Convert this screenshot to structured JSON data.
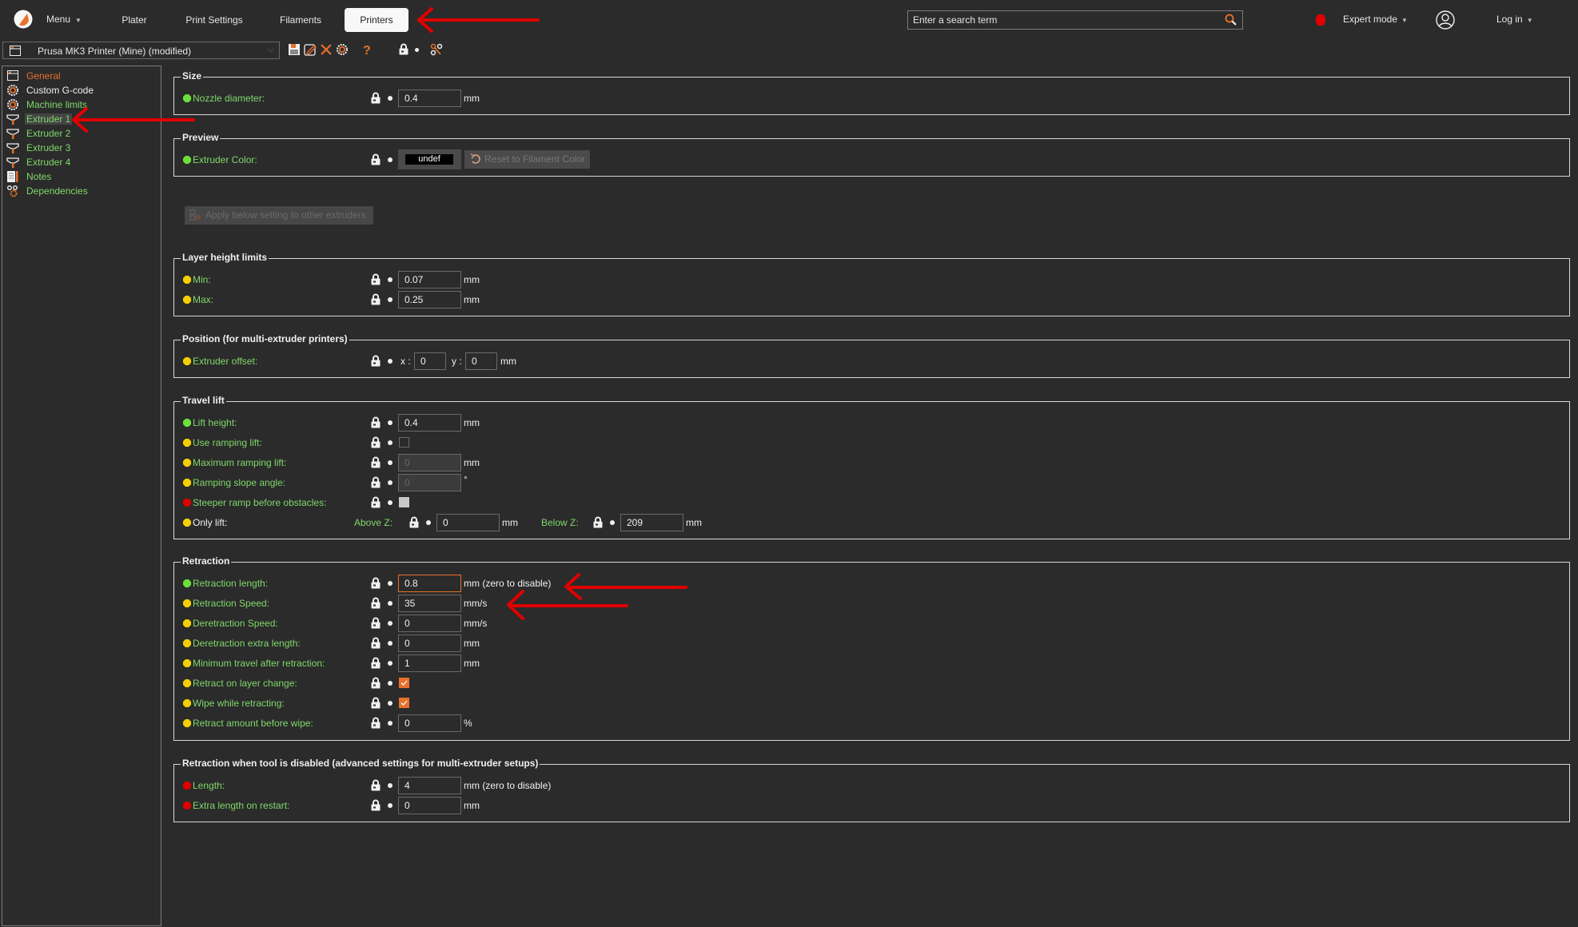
{
  "topbar": {
    "menu_label": "Menu",
    "tabs": [
      {
        "label": "Plater",
        "active": false
      },
      {
        "label": "Print Settings",
        "active": false
      },
      {
        "label": "Filaments",
        "active": false
      },
      {
        "label": "Printers",
        "active": true
      }
    ],
    "search_placeholder": "Enter a search term",
    "mode_label": "Expert mode",
    "mode_color": "#e00000",
    "login_label": "Log in"
  },
  "preset": {
    "name": "Prusa MK3 Printer (Mine) (modified)",
    "toolbar_icons": [
      "save-icon",
      "rename-icon",
      "delete-icon",
      "compare-icon",
      "help-icon",
      "lock-icon",
      "dot-icon",
      "dependencies-icon"
    ]
  },
  "sidebar": {
    "items": [
      {
        "label": "General",
        "icon": "general-icon",
        "color": "#e8702a",
        "selected": false
      },
      {
        "label": "Custom G-code",
        "icon": "gcode-gear-icon",
        "color": "#f0f0f0",
        "selected": false
      },
      {
        "label": "Machine limits",
        "icon": "limits-gear-icon",
        "color": "#7fd86a",
        "selected": false
      },
      {
        "label": "Extruder 1",
        "icon": "extruder-icon",
        "color": "#7fd86a",
        "selected": true
      },
      {
        "label": "Extruder 2",
        "icon": "extruder-icon",
        "color": "#7fd86a",
        "selected": false
      },
      {
        "label": "Extruder 3",
        "icon": "extruder-icon",
        "color": "#7fd86a",
        "selected": false
      },
      {
        "label": "Extruder 4",
        "icon": "extruder-icon",
        "color": "#7fd86a",
        "selected": false
      },
      {
        "label": "Notes",
        "icon": "notes-icon",
        "color": "#7fd86a",
        "selected": false
      },
      {
        "label": "Dependencies",
        "icon": "dependencies-icon",
        "color": "#7fd86a",
        "selected": false
      }
    ]
  },
  "colors": {
    "simple": "#6be03a",
    "advanced": "#f5d000",
    "expert": "#e00000",
    "accent": "#e8702a",
    "label_green": "#7fd86a"
  },
  "groups": {
    "size": {
      "title": "Size",
      "nozzle": {
        "label": "Nozzle diameter:",
        "value": "0.4",
        "unit": "mm",
        "level": "simple"
      }
    },
    "preview": {
      "title": "Preview",
      "color": {
        "label": "Extruder Color:",
        "value": "undef",
        "reset_label": "Reset to Filament Color",
        "level": "simple"
      }
    },
    "apply_label": "Apply below setting to other extruders",
    "layer_height": {
      "title": "Layer height limits",
      "min": {
        "label": "Min:",
        "value": "0.07",
        "unit": "mm",
        "level": "advanced"
      },
      "max": {
        "label": "Max:",
        "value": "0.25",
        "unit": "mm",
        "level": "advanced"
      }
    },
    "position": {
      "title": "Position (for multi-extruder printers)",
      "offset": {
        "label": "Extruder offset:",
        "x_label": "x :",
        "x_value": "0",
        "y_label": "y :",
        "y_value": "0",
        "unit": "mm",
        "level": "advanced"
      }
    },
    "travel_lift": {
      "title": "Travel lift",
      "lift_height": {
        "label": "Lift height:",
        "value": "0.4",
        "unit": "mm",
        "level": "simple"
      },
      "use_ramping": {
        "label": "Use ramping lift:",
        "checked": false,
        "level": "advanced"
      },
      "max_ramping": {
        "label": "Maximum ramping lift:",
        "value": "0",
        "unit": "mm",
        "disabled": true,
        "level": "advanced"
      },
      "slope_angle": {
        "label": "Ramping slope angle:",
        "value": "0",
        "unit": "°",
        "disabled": true,
        "level": "advanced"
      },
      "steeper": {
        "label": "Steeper ramp before obstacles:",
        "checked": false,
        "disabled": true,
        "level": "expert"
      },
      "only_lift": {
        "label": "Only lift:",
        "above_label": "Above Z:",
        "above_value": "0",
        "above_unit": "mm",
        "below_label": "Below Z:",
        "below_value": "209",
        "below_unit": "mm",
        "level": "advanced"
      }
    },
    "retraction": {
      "title": "Retraction",
      "length": {
        "label": "Retraction length:",
        "value": "0.8",
        "unit": "mm (zero to disable)",
        "level": "simple",
        "focused": true
      },
      "speed": {
        "label": "Retraction Speed:",
        "value": "35",
        "unit": "mm/s",
        "level": "advanced"
      },
      "deretraction_speed": {
        "label": "Deretraction Speed:",
        "value": "0",
        "unit": "mm/s",
        "level": "advanced"
      },
      "deretraction_extra": {
        "label": "Deretraction extra length:",
        "value": "0",
        "unit": "mm",
        "level": "advanced"
      },
      "min_travel": {
        "label": "Minimum travel after retraction:",
        "value": "1",
        "unit": "mm",
        "level": "advanced"
      },
      "retract_layer_change": {
        "label": "Retract on layer change:",
        "checked": true,
        "level": "advanced"
      },
      "wipe": {
        "label": "Wipe while retracting:",
        "checked": true,
        "level": "advanced"
      },
      "retract_before_wipe": {
        "label": "Retract amount before wipe:",
        "value": "0",
        "unit": "%",
        "level": "advanced"
      }
    },
    "tool_disabled": {
      "title": "Retraction when tool is disabled (advanced settings for multi-extruder setups)",
      "length": {
        "label": "Length:",
        "value": "4",
        "unit": "mm (zero to disable)",
        "level": "expert"
      },
      "extra_restart": {
        "label": "Extra length on restart:",
        "value": "0",
        "unit": "mm",
        "level": "expert"
      }
    }
  },
  "annotations": {
    "arrow_color": "#e00000"
  }
}
